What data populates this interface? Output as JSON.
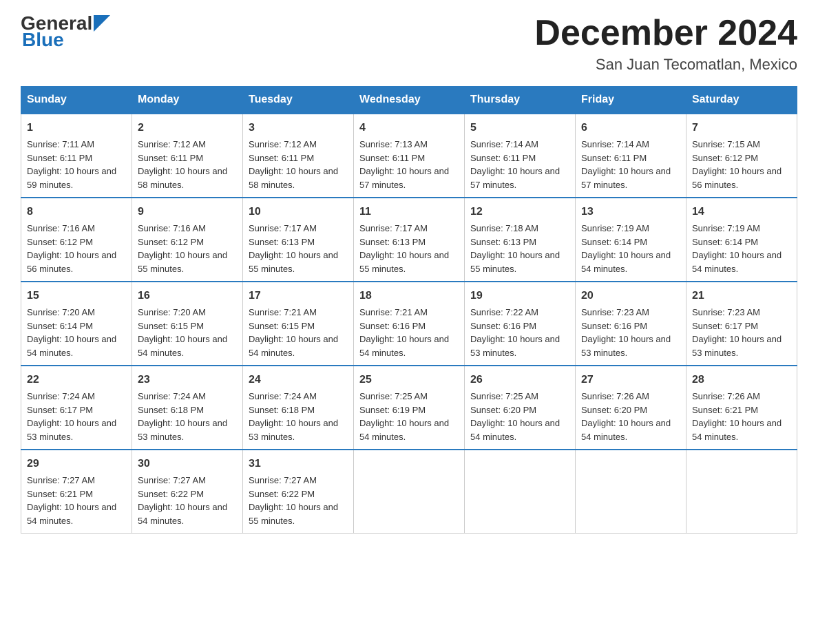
{
  "logo": {
    "part1": "General",
    "part2": "Blue"
  },
  "title": "December 2024",
  "subtitle": "San Juan Tecomatlan, Mexico",
  "days_of_week": [
    "Sunday",
    "Monday",
    "Tuesday",
    "Wednesday",
    "Thursday",
    "Friday",
    "Saturday"
  ],
  "weeks": [
    [
      {
        "day": "1",
        "sunrise": "7:11 AM",
        "sunset": "6:11 PM",
        "daylight": "10 hours and 59 minutes."
      },
      {
        "day": "2",
        "sunrise": "7:12 AM",
        "sunset": "6:11 PM",
        "daylight": "10 hours and 58 minutes."
      },
      {
        "day": "3",
        "sunrise": "7:12 AM",
        "sunset": "6:11 PM",
        "daylight": "10 hours and 58 minutes."
      },
      {
        "day": "4",
        "sunrise": "7:13 AM",
        "sunset": "6:11 PM",
        "daylight": "10 hours and 57 minutes."
      },
      {
        "day": "5",
        "sunrise": "7:14 AM",
        "sunset": "6:11 PM",
        "daylight": "10 hours and 57 minutes."
      },
      {
        "day": "6",
        "sunrise": "7:14 AM",
        "sunset": "6:11 PM",
        "daylight": "10 hours and 57 minutes."
      },
      {
        "day": "7",
        "sunrise": "7:15 AM",
        "sunset": "6:12 PM",
        "daylight": "10 hours and 56 minutes."
      }
    ],
    [
      {
        "day": "8",
        "sunrise": "7:16 AM",
        "sunset": "6:12 PM",
        "daylight": "10 hours and 56 minutes."
      },
      {
        "day": "9",
        "sunrise": "7:16 AM",
        "sunset": "6:12 PM",
        "daylight": "10 hours and 55 minutes."
      },
      {
        "day": "10",
        "sunrise": "7:17 AM",
        "sunset": "6:13 PM",
        "daylight": "10 hours and 55 minutes."
      },
      {
        "day": "11",
        "sunrise": "7:17 AM",
        "sunset": "6:13 PM",
        "daylight": "10 hours and 55 minutes."
      },
      {
        "day": "12",
        "sunrise": "7:18 AM",
        "sunset": "6:13 PM",
        "daylight": "10 hours and 55 minutes."
      },
      {
        "day": "13",
        "sunrise": "7:19 AM",
        "sunset": "6:14 PM",
        "daylight": "10 hours and 54 minutes."
      },
      {
        "day": "14",
        "sunrise": "7:19 AM",
        "sunset": "6:14 PM",
        "daylight": "10 hours and 54 minutes."
      }
    ],
    [
      {
        "day": "15",
        "sunrise": "7:20 AM",
        "sunset": "6:14 PM",
        "daylight": "10 hours and 54 minutes."
      },
      {
        "day": "16",
        "sunrise": "7:20 AM",
        "sunset": "6:15 PM",
        "daylight": "10 hours and 54 minutes."
      },
      {
        "day": "17",
        "sunrise": "7:21 AM",
        "sunset": "6:15 PM",
        "daylight": "10 hours and 54 minutes."
      },
      {
        "day": "18",
        "sunrise": "7:21 AM",
        "sunset": "6:16 PM",
        "daylight": "10 hours and 54 minutes."
      },
      {
        "day": "19",
        "sunrise": "7:22 AM",
        "sunset": "6:16 PM",
        "daylight": "10 hours and 53 minutes."
      },
      {
        "day": "20",
        "sunrise": "7:23 AM",
        "sunset": "6:16 PM",
        "daylight": "10 hours and 53 minutes."
      },
      {
        "day": "21",
        "sunrise": "7:23 AM",
        "sunset": "6:17 PM",
        "daylight": "10 hours and 53 minutes."
      }
    ],
    [
      {
        "day": "22",
        "sunrise": "7:24 AM",
        "sunset": "6:17 PM",
        "daylight": "10 hours and 53 minutes."
      },
      {
        "day": "23",
        "sunrise": "7:24 AM",
        "sunset": "6:18 PM",
        "daylight": "10 hours and 53 minutes."
      },
      {
        "day": "24",
        "sunrise": "7:24 AM",
        "sunset": "6:18 PM",
        "daylight": "10 hours and 53 minutes."
      },
      {
        "day": "25",
        "sunrise": "7:25 AM",
        "sunset": "6:19 PM",
        "daylight": "10 hours and 54 minutes."
      },
      {
        "day": "26",
        "sunrise": "7:25 AM",
        "sunset": "6:20 PM",
        "daylight": "10 hours and 54 minutes."
      },
      {
        "day": "27",
        "sunrise": "7:26 AM",
        "sunset": "6:20 PM",
        "daylight": "10 hours and 54 minutes."
      },
      {
        "day": "28",
        "sunrise": "7:26 AM",
        "sunset": "6:21 PM",
        "daylight": "10 hours and 54 minutes."
      }
    ],
    [
      {
        "day": "29",
        "sunrise": "7:27 AM",
        "sunset": "6:21 PM",
        "daylight": "10 hours and 54 minutes."
      },
      {
        "day": "30",
        "sunrise": "7:27 AM",
        "sunset": "6:22 PM",
        "daylight": "10 hours and 54 minutes."
      },
      {
        "day": "31",
        "sunrise": "7:27 AM",
        "sunset": "6:22 PM",
        "daylight": "10 hours and 55 minutes."
      },
      null,
      null,
      null,
      null
    ]
  ]
}
